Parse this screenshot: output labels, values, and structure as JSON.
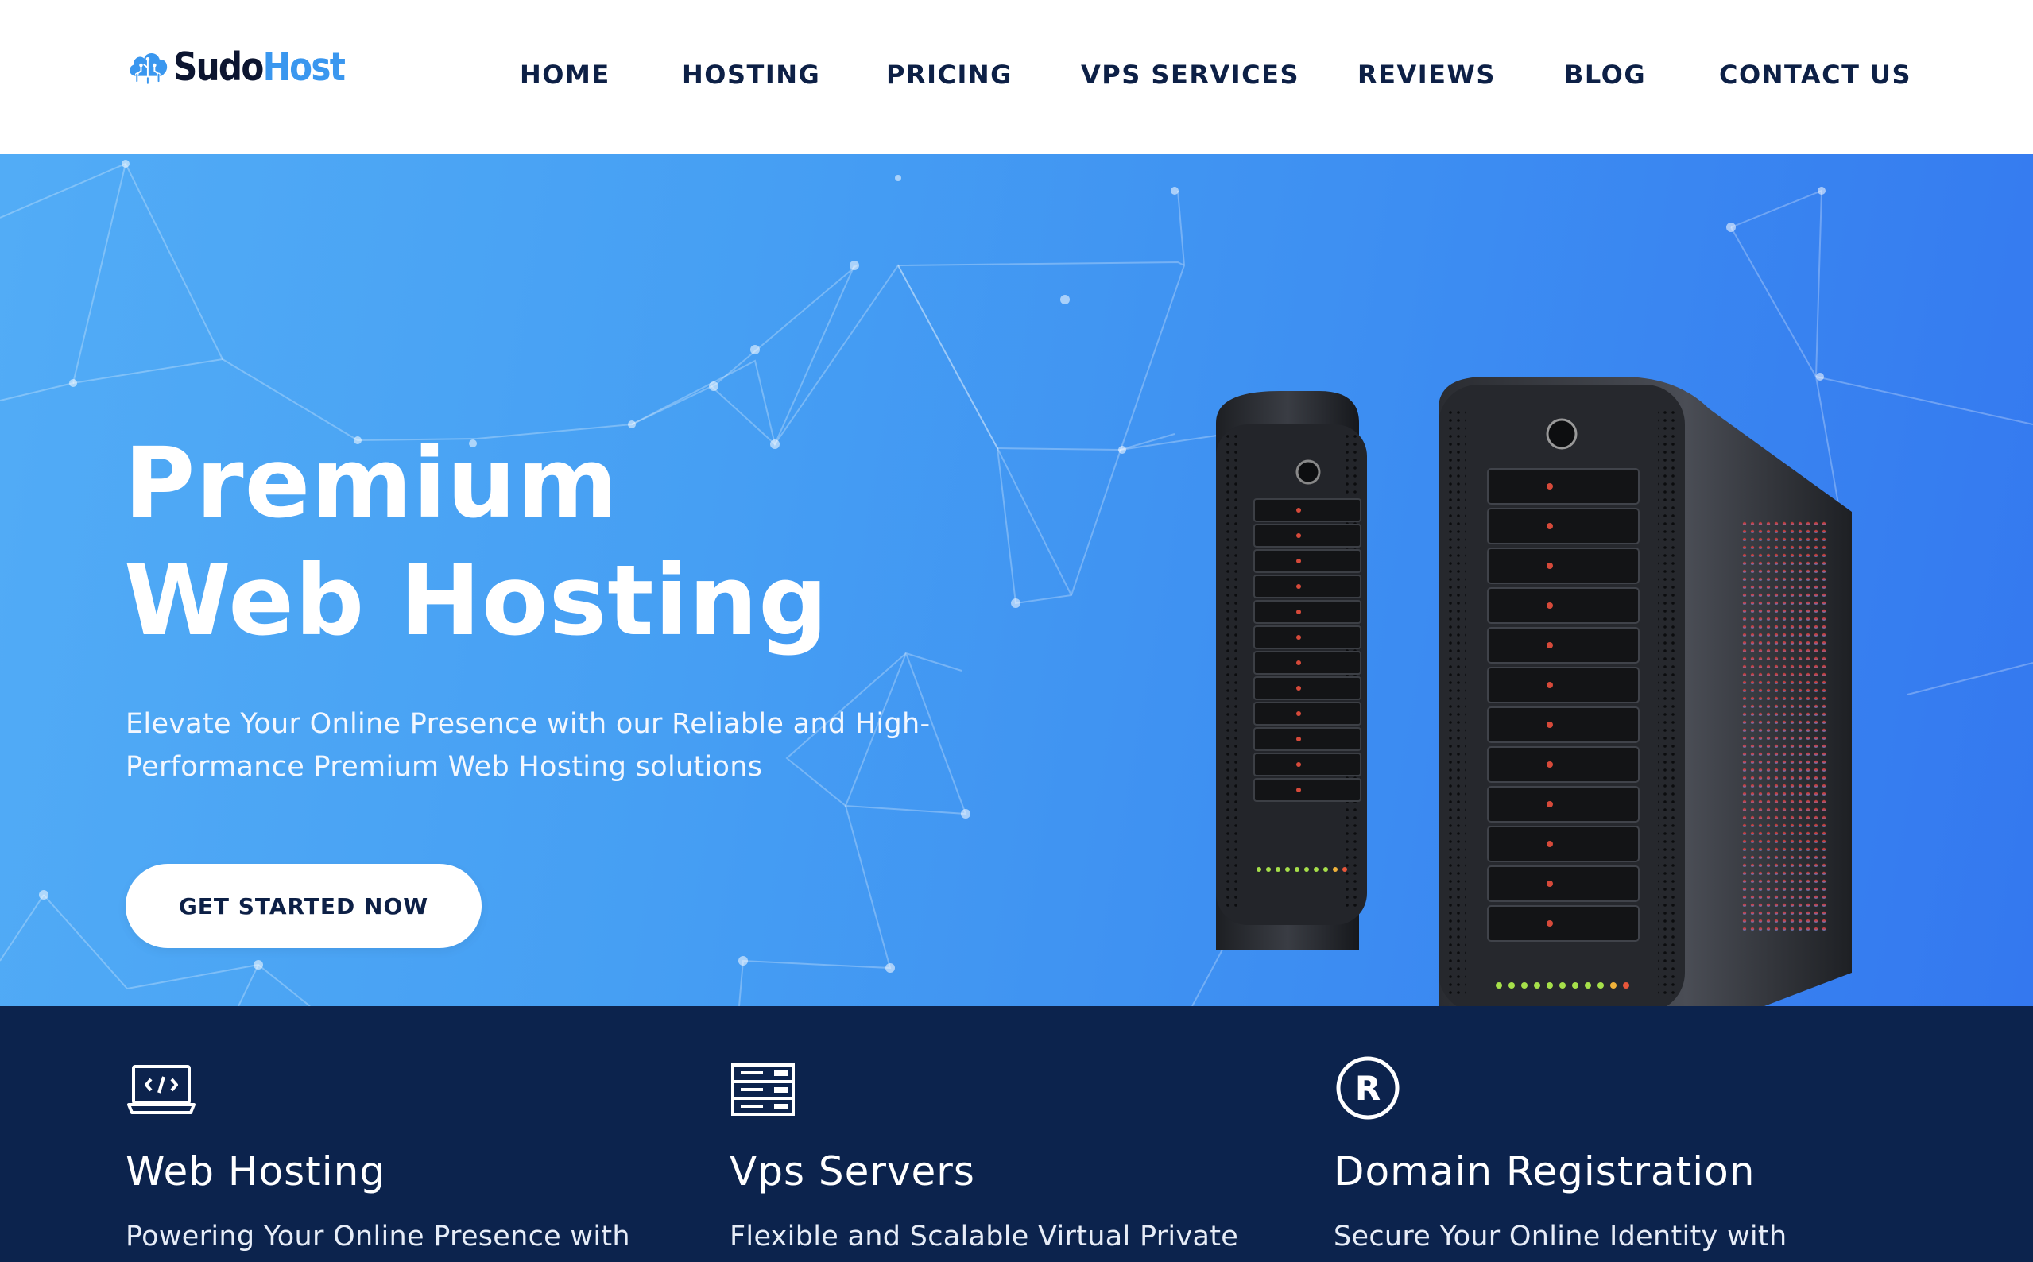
{
  "brand": {
    "name_part1": "Sudo",
    "name_part2": "Host"
  },
  "nav": {
    "items": [
      {
        "label": "HOME"
      },
      {
        "label": "HOSTING"
      },
      {
        "label": "PRICING"
      },
      {
        "label": "VPS SERVICES"
      },
      {
        "label": "REVIEWS"
      },
      {
        "label": "BLOG"
      },
      {
        "label": "CONTACT US"
      }
    ]
  },
  "hero": {
    "title_line1": "Premium",
    "title_line2": "Web Hosting",
    "subtitle_line1": "Elevate Your Online Presence with our Reliable and High-",
    "subtitle_line2": "Performance Premium Web Hosting solutions",
    "cta_label": "GET STARTED NOW"
  },
  "features": [
    {
      "icon": "laptop-code-icon",
      "title": "Web Hosting",
      "desc": "Powering Your Online Presence with"
    },
    {
      "icon": "server-rack-icon",
      "title": "Vps Servers",
      "desc": "Flexible and Scalable Virtual Private"
    },
    {
      "icon": "registered-icon",
      "title": "Domain Registration",
      "desc": "Secure Your Online Identity with"
    }
  ],
  "colors": {
    "brand_dark": "#0c1530",
    "brand_blue": "#3a97ef",
    "nav_text": "#0d2046",
    "hero_gradient_start": "#52acf6",
    "hero_gradient_end": "#3478ef",
    "features_bg": "#0c234d"
  }
}
